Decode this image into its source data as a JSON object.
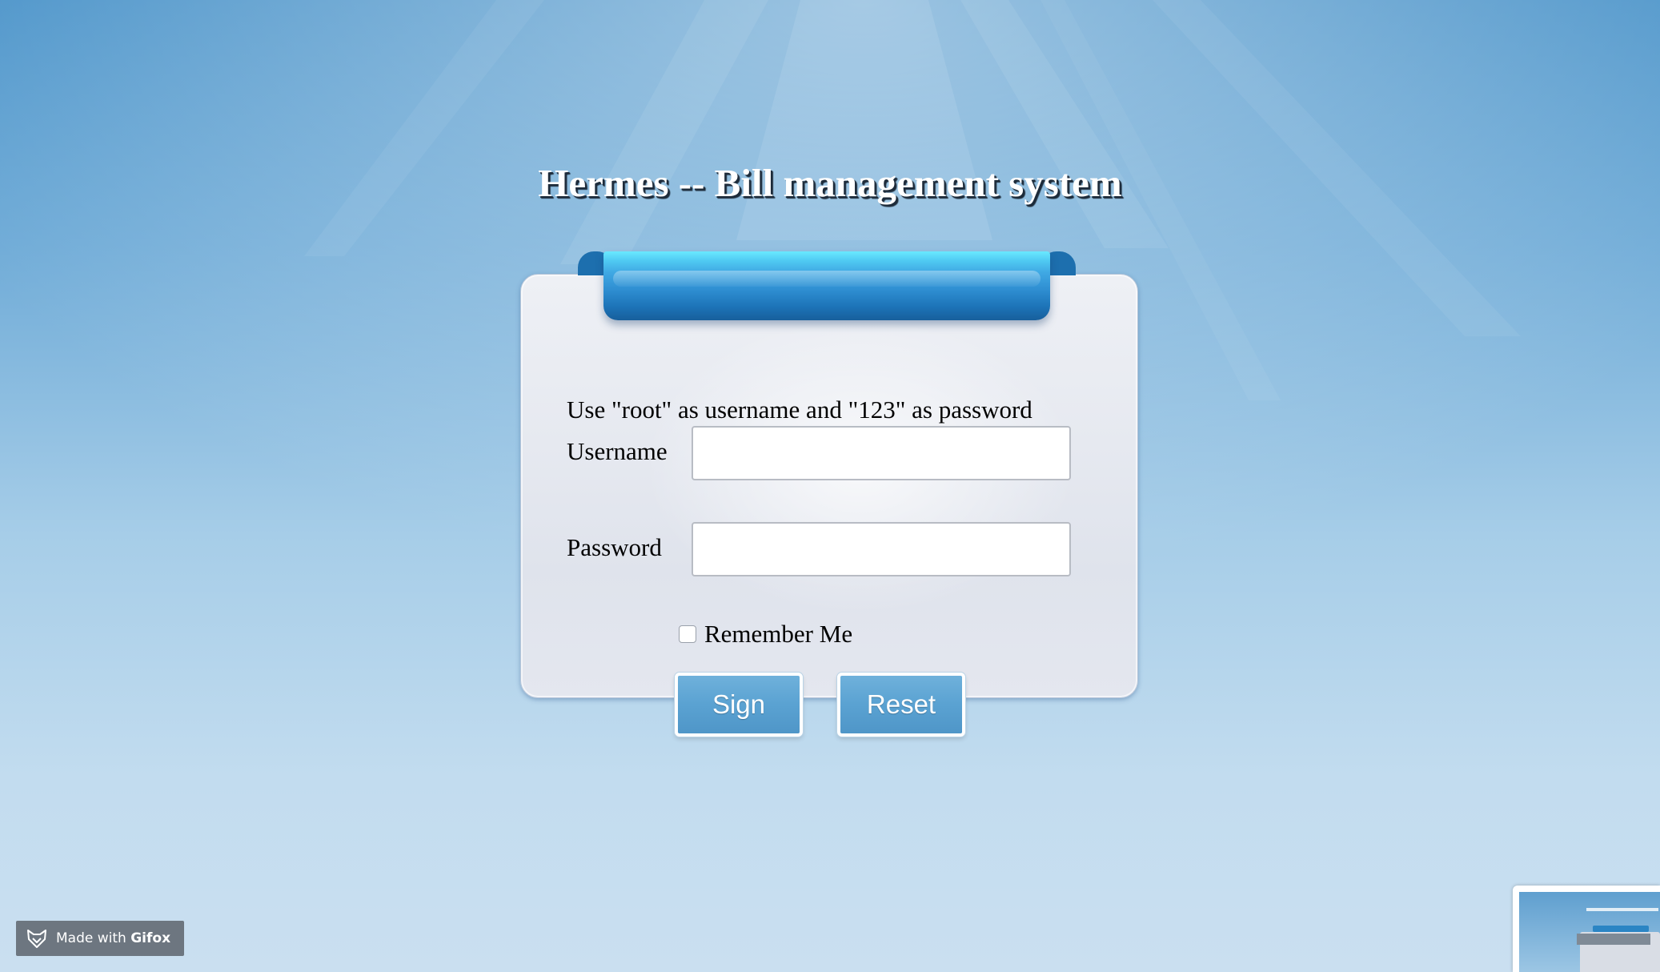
{
  "page": {
    "title": "Hermes -- Bill management system"
  },
  "login": {
    "hint": "Use \"root\" as username and \"123\" as password",
    "username_label": "Username",
    "username_value": "",
    "password_label": "Password",
    "password_value": "",
    "remember_label": "Remember Me",
    "remember_checked": false,
    "sign_label": "Sign",
    "reset_label": "Reset"
  },
  "overlay": {
    "badge_prefix": "Made with ",
    "badge_brand": "Gifox",
    "badge_icon": "fox-icon"
  },
  "colors": {
    "background_top": "#4a93c9",
    "background_bottom": "#cadff0",
    "ribbon": "#2f8fd2",
    "button": "#5aa2d2",
    "badge": "#6d7680"
  }
}
